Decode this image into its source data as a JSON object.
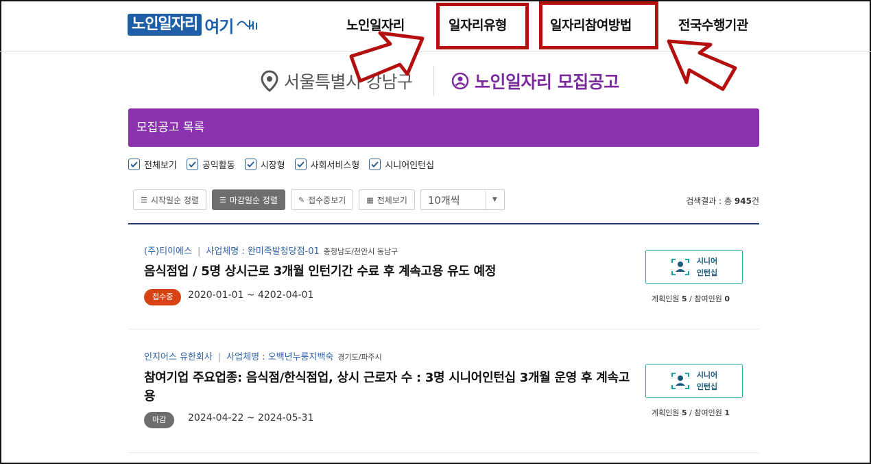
{
  "header": {
    "logo_main": "노인일자리",
    "logo_accent": "여기",
    "nav": [
      "노인일자리",
      "일자리유형",
      "일자리참여방법",
      "전국수행기관"
    ]
  },
  "location": {
    "region": "서울특별시 강남구",
    "title": "노인일자리 모집공고"
  },
  "list_header": "모집공고 목록",
  "filters": [
    "전체보기",
    "공익활동",
    "시장형",
    "사회서비스형",
    "시니어인턴십"
  ],
  "toolbar": {
    "sort_start": "시작일순 정렬",
    "sort_end": "마감일순 정렬",
    "open_only": "접수중보기",
    "view_all": "전체보기",
    "per_page": "10개씩"
  },
  "result": {
    "label": "검색결과 : 총",
    "count": "945",
    "unit": "건"
  },
  "listings": [
    {
      "company": "(주)티이에스",
      "business": "사업체명 : 완미족발청당점-01",
      "region": "충청남도/천안시 동남구",
      "title": "음식점업 / 5명 상시근로 3개월 인턴기간 수료 후 계속고용 유도 예정",
      "status": "접수중",
      "dates": "2020-01-01 ~ 4202-04-01",
      "type_line1": "시니어",
      "type_line2": "인턴십",
      "planned_label": "계획인원",
      "planned": "5",
      "joined_label": "참여인원",
      "joined": "0"
    },
    {
      "company": "인지어스 유한회사",
      "business": "사업체명 : 오백년누룽지백숙",
      "region": "경기도/파주시",
      "title": "참여기업 주요업종: 음식점/한식점업, 상시 근로자 수 : 3명 시니어인턴십 3개월 운영 후 계속고용",
      "status": "마감",
      "dates": "2024-04-22 ~ 2024-05-31",
      "type_line1": "시니어",
      "type_line2": "인턴십",
      "planned_label": "계획인원",
      "planned": "5",
      "joined_label": "참여인원",
      "joined": "1"
    }
  ],
  "colors": {
    "primary_purple": "#8a32b0",
    "highlight_red": "#b40f0f",
    "open_badge": "#d84315",
    "closed_badge": "#6e6e6e",
    "teal": "#1aa3a6",
    "navy": "#1d3a6e"
  }
}
